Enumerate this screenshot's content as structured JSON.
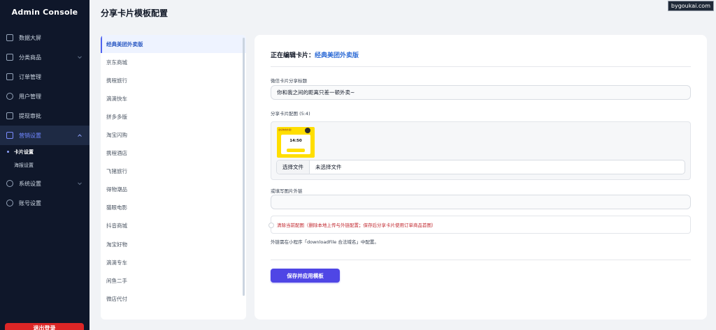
{
  "app": {
    "title": "Admin Console"
  },
  "sidebar": {
    "items": [
      {
        "label": "数据大屏",
        "icon": "monitor-icon"
      },
      {
        "label": "分类商品",
        "icon": "box-icon"
      },
      {
        "label": "订单管理",
        "icon": "list-icon"
      },
      {
        "label": "用户管理",
        "icon": "users-icon"
      },
      {
        "label": "提现审批",
        "icon": "bank-icon"
      },
      {
        "label": "营销设置",
        "icon": "megaphone-icon"
      }
    ],
    "submenu": [
      {
        "label": "卡片设置"
      },
      {
        "label": "海报设置"
      }
    ],
    "items_after": [
      {
        "label": "系统设置",
        "icon": "gear-icon"
      },
      {
        "label": "账号设置",
        "icon": "user-icon"
      }
    ],
    "logout_label": "退出登录"
  },
  "header": {
    "title": "分享卡片模板配置",
    "watermark": "bygoukai.com"
  },
  "templates": [
    "经典美团外卖版",
    "京东商城",
    "携程旅行",
    "滴滴快车",
    "拼多多版",
    "淘宝闪购",
    "携程酒店",
    "飞猪旅行",
    "得物潮品",
    "猫眼电影",
    "抖音商城",
    "淘宝好物",
    "滴滴专车",
    "闲鱼二手",
    "微店代付"
  ],
  "editor": {
    "heading_prefix": "正在编辑卡片：",
    "heading_name": "经典美团外卖版",
    "share_title_label": "微信卡片分享标题",
    "share_title_value": "你和我之间的距离只差一顿外卖~",
    "image_label": "分享卡片配图 (5:4)",
    "thumb": {
      "top_text": "拿好你的外卖！",
      "time": "14:50"
    },
    "file_button": "选择文件",
    "file_status": "未选择文件",
    "external_label": "或填写图片外链",
    "external_value": "",
    "clear_text": "清除当前配图（删除本地上传与外链配置；保存后分享卡片使用订单商品首图）",
    "hint": "外链需在小程序「downloadFile 合法域名」中配置。",
    "save_label": "保存并应用模板"
  },
  "colors": {
    "accent": "#4f46e5",
    "sidebar_bg": "#0f172a",
    "danger": "#dc2626",
    "link": "#2d6bd6"
  }
}
